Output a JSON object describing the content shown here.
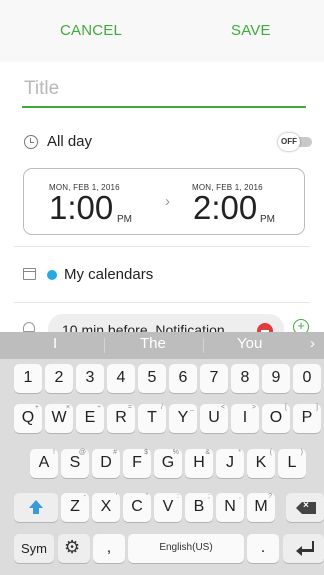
{
  "action_bar": {
    "cancel": "CANCEL",
    "save": "SAVE"
  },
  "title": {
    "placeholder": "Title"
  },
  "all_day": {
    "label": "All day",
    "toggle": "OFF"
  },
  "time": {
    "start_date": "MON, FEB 1, 2016",
    "start_time": "1:00",
    "start_ampm": "PM",
    "arrow": "›",
    "end_date": "MON, FEB 1, 2016",
    "end_time": "2:00",
    "end_ampm": "PM"
  },
  "calendar": {
    "label": "My calendars",
    "dot_color": "#27a9e1"
  },
  "notification": {
    "text": "10 min before, Notification",
    "plus": "+"
  },
  "keyboard": {
    "suggestions": [
      "I",
      "The",
      "You"
    ],
    "more": "›",
    "numbers": [
      "1",
      "2",
      "3",
      "4",
      "5",
      "6",
      "7",
      "8",
      "9",
      "0"
    ],
    "row1": [
      {
        "k": "Q",
        "s": "+"
      },
      {
        "k": "W",
        "s": "×"
      },
      {
        "k": "E",
        "s": "÷"
      },
      {
        "k": "R",
        "s": "="
      },
      {
        "k": "T",
        "s": "/"
      },
      {
        "k": "Y",
        "s": "_"
      },
      {
        "k": "U",
        "s": "<"
      },
      {
        "k": "I",
        "s": ">"
      },
      {
        "k": "O",
        "s": "["
      },
      {
        "k": "P",
        "s": "]"
      }
    ],
    "row2": [
      {
        "k": "A",
        "s": "!"
      },
      {
        "k": "S",
        "s": "@"
      },
      {
        "k": "D",
        "s": "#"
      },
      {
        "k": "F",
        "s": "$"
      },
      {
        "k": "G",
        "s": "%"
      },
      {
        "k": "H",
        "s": "&"
      },
      {
        "k": "J",
        "s": "*"
      },
      {
        "k": "K",
        "s": "("
      },
      {
        "k": "L",
        "s": ")"
      }
    ],
    "row3": [
      {
        "k": "Z",
        "s": "-"
      },
      {
        "k": "X",
        "s": "'"
      },
      {
        "k": "C",
        "s": "\""
      },
      {
        "k": "V",
        "s": ":"
      },
      {
        "k": "B",
        "s": ";"
      },
      {
        "k": "N",
        "s": ","
      },
      {
        "k": "M",
        "s": "?"
      }
    ],
    "sym": "Sym",
    "gear": "⚙",
    "comma": ",",
    "space": "English(US)",
    "period": "."
  },
  "colors": {
    "accent": "#3fab3a",
    "shift": "#3a9ad9",
    "minus": "#e03c3c"
  }
}
